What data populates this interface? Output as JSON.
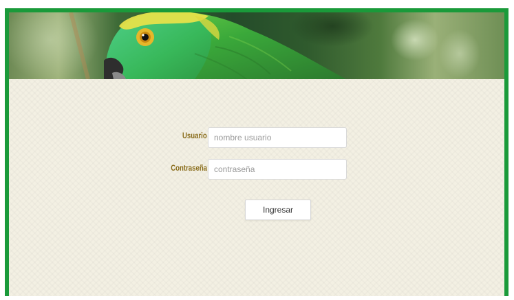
{
  "banner": {
    "image": "parrot-photo"
  },
  "login": {
    "username_label": "Usuario",
    "username_placeholder": "nombre usuario",
    "password_label": "Contraseña",
    "password_placeholder": "contraseña",
    "submit_label": "Ingresar"
  },
  "colors": {
    "frame_border": "#1a9a3a",
    "label": "#8a6d1c",
    "background": "#f3f0e3"
  }
}
